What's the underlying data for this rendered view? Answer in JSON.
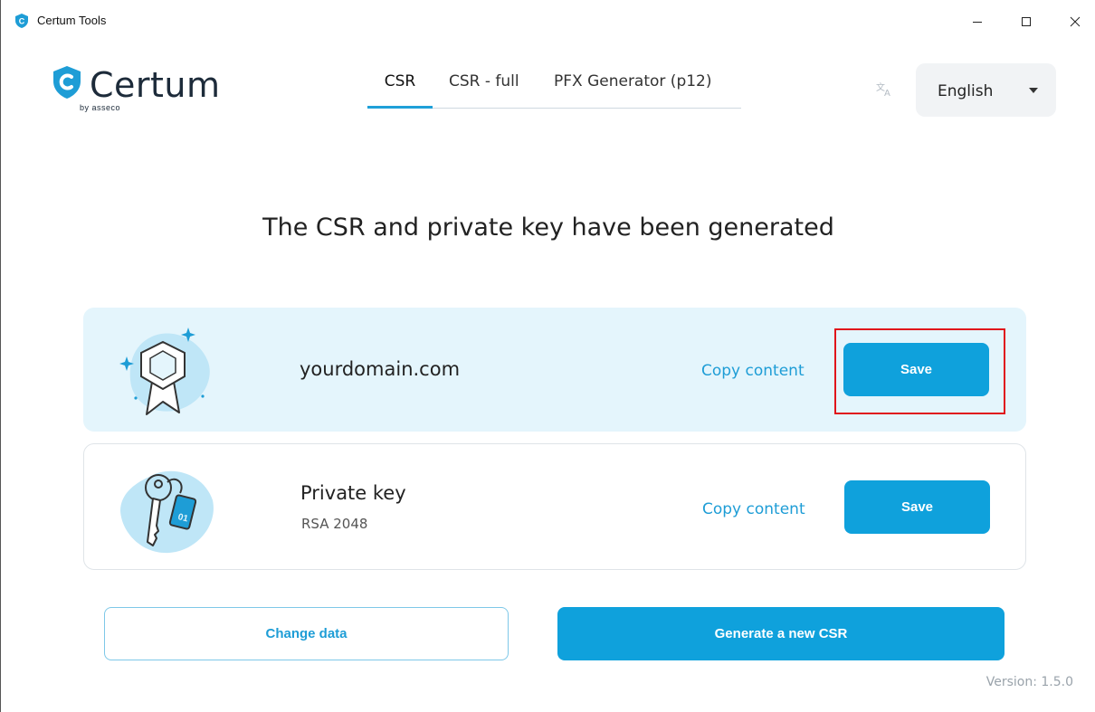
{
  "window": {
    "title": "Certum Tools",
    "controls": {
      "minimize": "–",
      "maximize": "☐",
      "close": "✕"
    }
  },
  "brand": {
    "name": "Certum",
    "sub": "by asseco",
    "accent_color": "#0fa1dc"
  },
  "nav": {
    "tabs": [
      {
        "label": "CSR",
        "active": true
      },
      {
        "label": "CSR - full",
        "active": false
      },
      {
        "label": "PFX Generator (p12)",
        "active": false
      }
    ]
  },
  "language": {
    "icon": "translate-icon",
    "selected": "English"
  },
  "heading": "The CSR and private key have been generated",
  "cards": [
    {
      "icon": "certificate-icon",
      "title": "yourdomain.com",
      "subtitle": "",
      "copy_label": "Copy content",
      "save_label": "Save"
    },
    {
      "icon": "keys-icon",
      "title": "Private key",
      "subtitle": "RSA 2048",
      "tag_text": "01",
      "copy_label": "Copy content",
      "save_label": "Save"
    }
  ],
  "actions": {
    "change_data": "Change data",
    "generate_new": "Generate a new CSR"
  },
  "version": "Version: 1.5.0"
}
